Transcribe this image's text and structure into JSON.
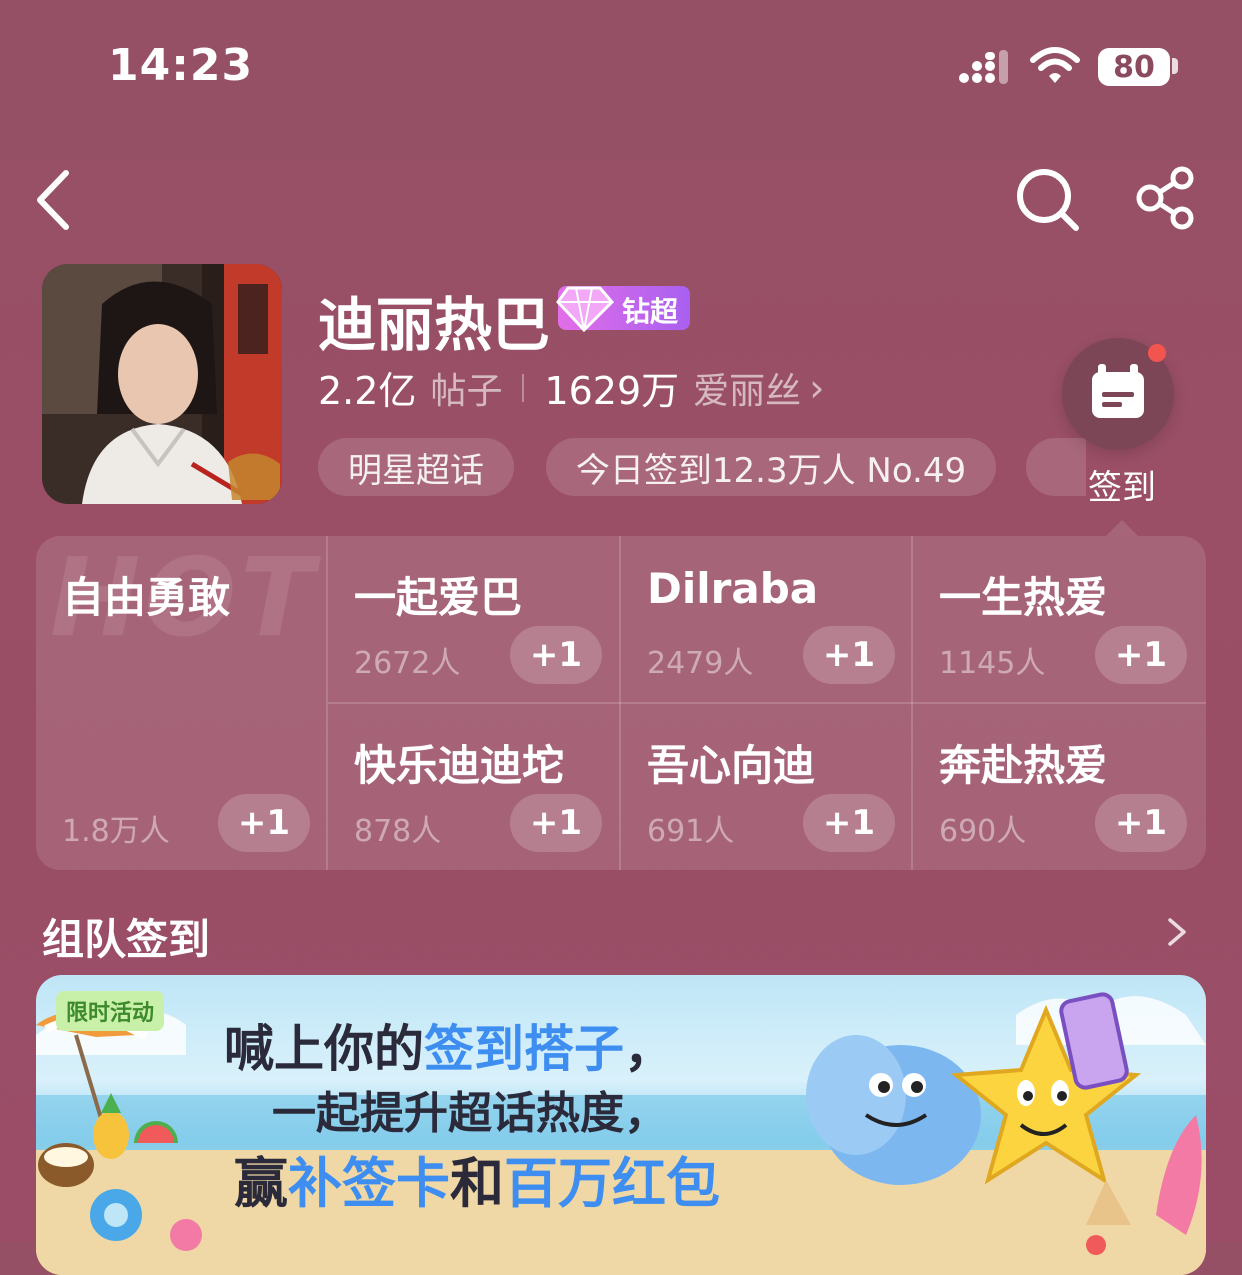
{
  "status_bar": {
    "time": "14:23",
    "battery": "80"
  },
  "header": {
    "title": "迪丽热巴",
    "badge": "钻超",
    "posts_count": "2.2亿",
    "posts_label": "帖子",
    "fans_count": "1629万",
    "fans_label": "爱丽丝",
    "chevron": "›",
    "tags": [
      "明星超话",
      "今日签到12.3万人 No.49"
    ]
  },
  "checkin": {
    "label": "签到"
  },
  "groups": [
    {
      "name": "自由勇敢",
      "count": "1.8万人",
      "plus": "+1",
      "watermark": "HOT"
    },
    {
      "name": "一起爱巴",
      "count": "2672人",
      "plus": "+1"
    },
    {
      "name": "Dilraba",
      "count": "2479人",
      "plus": "+1"
    },
    {
      "name": "一生热爱",
      "count": "1145人",
      "plus": "+1"
    },
    {
      "name": "快乐迪迪坨",
      "count": "878人",
      "plus": "+1"
    },
    {
      "name": "吾心向迪",
      "count": "691人",
      "plus": "+1"
    },
    {
      "name": "奔赴热爱",
      "count": "690人",
      "plus": "+1"
    }
  ],
  "team_section": {
    "title": "组队签到"
  },
  "banner": {
    "tag": "限时活动",
    "line1_a": "喊上你的",
    "line1_b": "签到搭子",
    "line1_c": "，",
    "line2": "一起提升超话热度，",
    "line3_a": "赢",
    "line3_b": "补签卡",
    "line3_c": "和",
    "line3_d": "百万红包"
  },
  "colors": {
    "accent_blue": "#3d8ef0",
    "badge_purple": "#b65ff0",
    "notify_red": "#f2554e"
  }
}
